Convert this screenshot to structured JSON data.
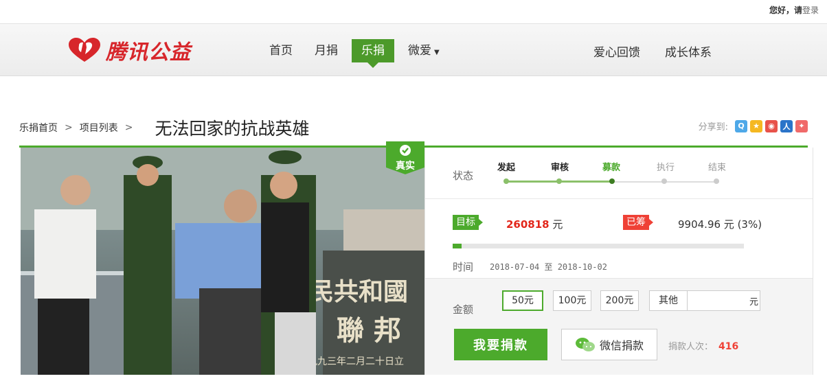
{
  "topbar": {
    "greeting": "您好，",
    "please": "请",
    "login": "登录"
  },
  "brand": {
    "name": "腾讯公益",
    "color": "#d7262b"
  },
  "nav": {
    "items": [
      {
        "label": "首页"
      },
      {
        "label": "月捐"
      },
      {
        "label": "乐捐",
        "active": true
      },
      {
        "label": "微爱",
        "dropdown": true
      }
    ],
    "right_items": [
      {
        "label": "爱心回馈"
      },
      {
        "label": "成长体系"
      }
    ]
  },
  "breadcrumb": {
    "home": "乐捐首页",
    "list": "项目列表",
    "sep": ">"
  },
  "page_title": "无法回家的抗战英雄",
  "share": {
    "label": "分享到:",
    "icons": [
      "qzone-icon",
      "qq-star-icon",
      "weibo-icon",
      "renren-icon",
      "kaixin-icon"
    ]
  },
  "verified_badge": "真实",
  "status": {
    "label": "状态",
    "steps": [
      "发起",
      "审核",
      "募款",
      "执行",
      "结束"
    ],
    "current_index": 2
  },
  "funding": {
    "target_tag": "目标",
    "target_amount": "260818",
    "target_unit": "元",
    "raised_tag": "已筹",
    "raised_text": "9904.96 元 (3%)",
    "progress_fraction": 0.03
  },
  "time": {
    "label": "时间",
    "range": "2018-07-04 至 2018-10-02"
  },
  "donate": {
    "amount_label": "金额",
    "options": [
      "50元",
      "100元",
      "200元",
      "其他"
    ],
    "selected_index": 0,
    "custom_unit": "元",
    "donate_button": "我要捐款",
    "wechat_button": "微信捐款",
    "donor_label": "捐款人次：",
    "donor_count": "416"
  },
  "colors": {
    "green": "#4caa2c",
    "red": "#ef4136",
    "nav_active": "#4c9a2a"
  }
}
